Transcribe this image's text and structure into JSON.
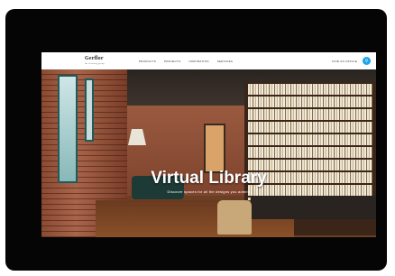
{
  "site": {
    "logo": "Gerflor",
    "logo_tagline": "the flooring group"
  },
  "nav": {
    "links": [
      "PRODUCTS",
      "PROJECTS",
      "INSPIRATION",
      "SERVICES"
    ],
    "cta": "FIND AN OFFICE"
  },
  "hero": {
    "title": "Virtual Library",
    "subtitle": "Discover spaces for all the designs you admire"
  },
  "colors": {
    "accent": "#1aa3e8",
    "device_frame": "#050505"
  }
}
